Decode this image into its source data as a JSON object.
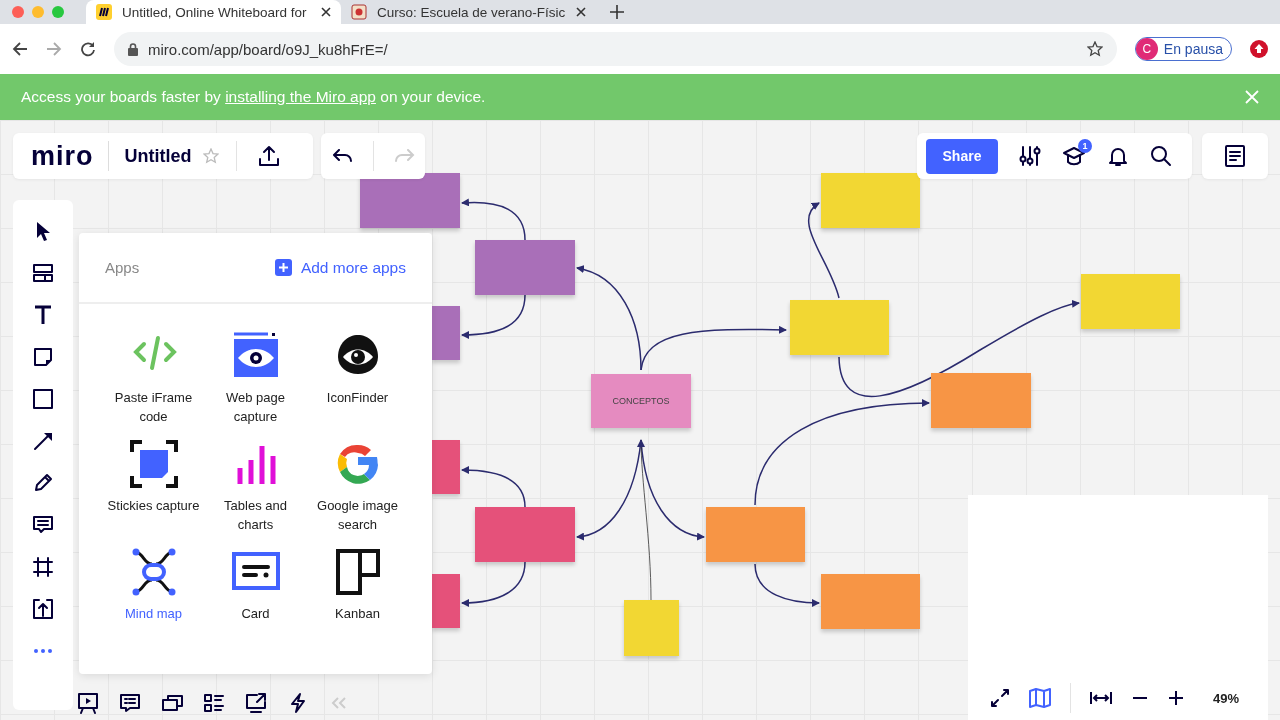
{
  "browser": {
    "tabs": [
      {
        "title": "Untitled, Online Whiteboard for",
        "selected": true
      },
      {
        "title": "Curso: Escuela de verano-Físic",
        "selected": false
      }
    ],
    "url": "miro.com/app/board/o9J_ku8hFrE=/",
    "profile": {
      "initial": "C",
      "status": "En pausa"
    }
  },
  "banner": {
    "before": "Access your boards faster by",
    "link": "installing the Miro app",
    "after": "on your device."
  },
  "board": {
    "logo": "miro",
    "title": "Untitled",
    "share": "Share",
    "notifications": "1",
    "zoom": "49%"
  },
  "apps_panel": {
    "title": "Apps",
    "add": "Add more apps",
    "apps": [
      {
        "kind": "iframe",
        "label": "Paste iFrame code",
        "selected": false
      },
      {
        "kind": "webcapture",
        "label": "Web page capture",
        "selected": false
      },
      {
        "kind": "iconfinder",
        "label": "IconFinder",
        "selected": false
      },
      {
        "kind": "stickies",
        "label": "Stickies capture",
        "selected": false
      },
      {
        "kind": "charts",
        "label": "Tables and charts",
        "selected": false
      },
      {
        "kind": "google",
        "label": "Google image search",
        "selected": false
      },
      {
        "kind": "mindmap",
        "label": "Mind map",
        "selected": true
      },
      {
        "kind": "card",
        "label": "Card",
        "selected": false
      },
      {
        "kind": "kanban",
        "label": "Kanban",
        "selected": false
      }
    ]
  },
  "stickies": [
    {
      "color": "#a96fb8"
    },
    {
      "color": "#a96fb8"
    },
    {
      "color": "#a96fb8"
    },
    {
      "color": "#e5517a"
    },
    {
      "color": "#e5517a"
    },
    {
      "color": "#e5517a"
    },
    {
      "color": "#e58bc0",
      "text": "CONCEPTOS"
    },
    {
      "color": "#f2d733"
    },
    {
      "color": "#f2d733"
    },
    {
      "color": "#f2d733"
    },
    {
      "color": "#f79545"
    },
    {
      "color": "#f79545"
    },
    {
      "color": "#f79545"
    },
    {
      "color": "#f2d733"
    }
  ]
}
